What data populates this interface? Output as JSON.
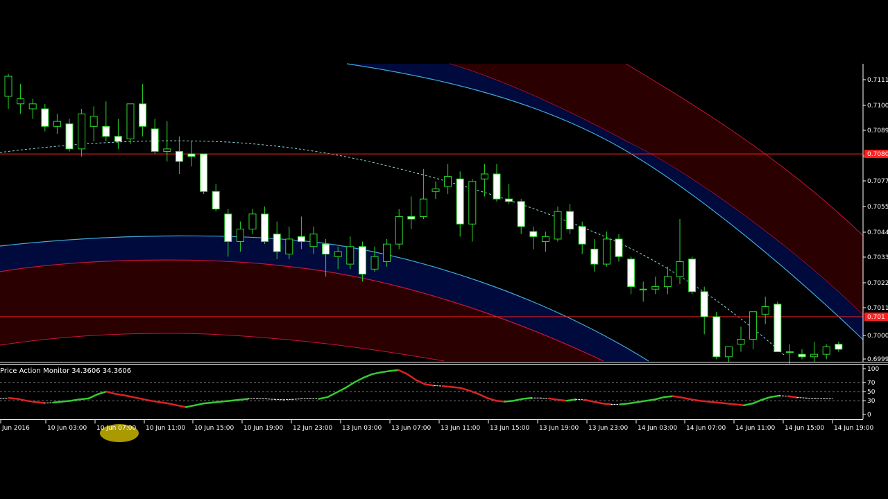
{
  "indicator": {
    "label": "Price Action Monitor 34.3606 34.3606",
    "levels": [
      "100",
      "70",
      "50",
      "30",
      "0"
    ]
  },
  "price_axis": {
    "labels": [
      "0.7111",
      "0.7100",
      "0.7089",
      "0.708",
      "0.7077",
      "0.7055",
      "0.7044",
      "0.7033",
      "0.7022",
      "0.7011",
      "0.7000",
      "0.6999"
    ]
  },
  "horizontal_lines": [
    {
      "price": 0.708,
      "label": "0.7080",
      "color": "#ff1f1f"
    },
    {
      "price": 0.7015,
      "label": "0.701",
      "color": "#ff1f1f"
    }
  ],
  "time_axis": {
    "labels": [
      "Jun 2016",
      "10 Jun 03:00",
      "10 Jun 07:00",
      "10 Jun 11:00",
      "10 Jun 15:00",
      "10 Jun 19:00",
      "12 Jun 23:00",
      "13 Jun 03:00",
      "13 Jun 07:00",
      "13 Jun 11:00",
      "13 Jun 15:00",
      "13 Jun 19:00",
      "13 Jun 23:00",
      "14 Jun 03:00",
      "14 Jun 07:00",
      "14 Jun 11:00",
      "14 Jun 15:00",
      "14 Jun 19:00"
    ]
  },
  "colors": {
    "background": "#000000",
    "candle_bull_fill": "#000000",
    "candle_bear_fill": "#ffffff",
    "candle_wick": "#2bd92b",
    "band_red_fill": "#2a0000",
    "band_red_line": "#c8143c",
    "band_blue_fill": "#000a3c",
    "band_blue_line": "#3fa9d8",
    "ma_dotted": "#8fdcdc",
    "indicator_up": "#33cc33",
    "indicator_down": "#dd2222",
    "indicator_neutral": "#ffffff"
  },
  "chart_data": {
    "type": "candlestick",
    "symbol_price_axis": "right",
    "ylim": [
      0.6997,
      0.7116
    ],
    "candles": [
      {
        "o": 0.7103,
        "h": 0.7112,
        "l": 0.7098,
        "c": 0.7111
      },
      {
        "o": 0.71,
        "h": 0.7108,
        "l": 0.7096,
        "c": 0.7102
      },
      {
        "o": 0.7098,
        "h": 0.7102,
        "l": 0.7094,
        "c": 0.71
      },
      {
        "o": 0.7098,
        "h": 0.71,
        "l": 0.7089,
        "c": 0.7091
      },
      {
        "o": 0.7091,
        "h": 0.7096,
        "l": 0.7088,
        "c": 0.7093
      },
      {
        "o": 0.7092,
        "h": 0.7094,
        "l": 0.7081,
        "c": 0.7082
      },
      {
        "o": 0.7082,
        "h": 0.7098,
        "l": 0.7079,
        "c": 0.7096
      },
      {
        "o": 0.7091,
        "h": 0.7099,
        "l": 0.7085,
        "c": 0.7095
      },
      {
        "o": 0.7091,
        "h": 0.7101,
        "l": 0.7085,
        "c": 0.7087
      },
      {
        "o": 0.7087,
        "h": 0.7094,
        "l": 0.7082,
        "c": 0.7085
      },
      {
        "o": 0.7086,
        "h": 0.71,
        "l": 0.7084,
        "c": 0.71
      },
      {
        "o": 0.71,
        "h": 0.7108,
        "l": 0.7087,
        "c": 0.7091
      },
      {
        "o": 0.709,
        "h": 0.7094,
        "l": 0.708,
        "c": 0.7081
      },
      {
        "o": 0.7081,
        "h": 0.7093,
        "l": 0.7077,
        "c": 0.7082
      },
      {
        "o": 0.7081,
        "h": 0.7087,
        "l": 0.7072,
        "c": 0.7077
      },
      {
        "o": 0.708,
        "h": 0.7085,
        "l": 0.7075,
        "c": 0.7079
      },
      {
        "o": 0.708,
        "h": 0.708,
        "l": 0.7064,
        "c": 0.7065
      },
      {
        "o": 0.7065,
        "h": 0.7068,
        "l": 0.7057,
        "c": 0.7058
      },
      {
        "o": 0.7056,
        "h": 0.7058,
        "l": 0.7039,
        "c": 0.7045
      },
      {
        "o": 0.7045,
        "h": 0.7053,
        "l": 0.7041,
        "c": 0.705
      },
      {
        "o": 0.705,
        "h": 0.7058,
        "l": 0.7048,
        "c": 0.7056
      },
      {
        "o": 0.7056,
        "h": 0.7059,
        "l": 0.7044,
        "c": 0.7045
      },
      {
        "o": 0.7048,
        "h": 0.7053,
        "l": 0.7038,
        "c": 0.7041
      },
      {
        "o": 0.704,
        "h": 0.7051,
        "l": 0.7038,
        "c": 0.7046
      },
      {
        "o": 0.7047,
        "h": 0.7055,
        "l": 0.7042,
        "c": 0.7045
      },
      {
        "o": 0.7043,
        "h": 0.7051,
        "l": 0.704,
        "c": 0.7048
      },
      {
        "o": 0.7044,
        "h": 0.7046,
        "l": 0.7031,
        "c": 0.704
      },
      {
        "o": 0.7039,
        "h": 0.7043,
        "l": 0.7034,
        "c": 0.7041
      },
      {
        "o": 0.7036,
        "h": 0.7047,
        "l": 0.7034,
        "c": 0.7043
      },
      {
        "o": 0.7043,
        "h": 0.7045,
        "l": 0.7029,
        "c": 0.7032
      },
      {
        "o": 0.7034,
        "h": 0.7043,
        "l": 0.7033,
        "c": 0.7039
      },
      {
        "o": 0.7037,
        "h": 0.7046,
        "l": 0.7035,
        "c": 0.7044
      },
      {
        "o": 0.7044,
        "h": 0.7058,
        "l": 0.7042,
        "c": 0.7055
      },
      {
        "o": 0.7055,
        "h": 0.7063,
        "l": 0.705,
        "c": 0.7054
      },
      {
        "o": 0.7055,
        "h": 0.7074,
        "l": 0.7054,
        "c": 0.7062
      },
      {
        "o": 0.7065,
        "h": 0.7069,
        "l": 0.7062,
        "c": 0.7066
      },
      {
        "o": 0.7067,
        "h": 0.7076,
        "l": 0.7064,
        "c": 0.7071
      },
      {
        "o": 0.707,
        "h": 0.7073,
        "l": 0.7047,
        "c": 0.7052
      },
      {
        "o": 0.7052,
        "h": 0.707,
        "l": 0.7045,
        "c": 0.7069
      },
      {
        "o": 0.707,
        "h": 0.7076,
        "l": 0.7063,
        "c": 0.7072
      },
      {
        "o": 0.7072,
        "h": 0.7076,
        "l": 0.7061,
        "c": 0.7062
      },
      {
        "o": 0.7062,
        "h": 0.7068,
        "l": 0.706,
        "c": 0.7061
      },
      {
        "o": 0.7061,
        "h": 0.7062,
        "l": 0.7048,
        "c": 0.7051
      },
      {
        "o": 0.7049,
        "h": 0.7051,
        "l": 0.7042,
        "c": 0.7047
      },
      {
        "o": 0.7045,
        "h": 0.7049,
        "l": 0.7041,
        "c": 0.7047
      },
      {
        "o": 0.7046,
        "h": 0.7059,
        "l": 0.7045,
        "c": 0.7057
      },
      {
        "o": 0.7057,
        "h": 0.706,
        "l": 0.7048,
        "c": 0.705
      },
      {
        "o": 0.7051,
        "h": 0.7053,
        "l": 0.704,
        "c": 0.7044
      },
      {
        "o": 0.7042,
        "h": 0.7046,
        "l": 0.7033,
        "c": 0.7036
      },
      {
        "o": 0.7036,
        "h": 0.7049,
        "l": 0.7035,
        "c": 0.7046
      },
      {
        "o": 0.7046,
        "h": 0.7048,
        "l": 0.7037,
        "c": 0.7039
      },
      {
        "o": 0.7038,
        "h": 0.7039,
        "l": 0.7024,
        "c": 0.7027
      },
      {
        "o": 0.7026,
        "h": 0.7029,
        "l": 0.7021,
        "c": 0.7026
      },
      {
        "o": 0.7026,
        "h": 0.7031,
        "l": 0.7024,
        "c": 0.7027
      },
      {
        "o": 0.7027,
        "h": 0.7035,
        "l": 0.7024,
        "c": 0.7031
      },
      {
        "o": 0.7031,
        "h": 0.7054,
        "l": 0.7028,
        "c": 0.7037
      },
      {
        "o": 0.7038,
        "h": 0.7039,
        "l": 0.7024,
        "c": 0.7025
      },
      {
        "o": 0.7025,
        "h": 0.7027,
        "l": 0.7008,
        "c": 0.7015
      },
      {
        "o": 0.7015,
        "h": 0.7017,
        "l": 0.6998,
        "c": 0.6999
      },
      {
        "o": 0.6999,
        "h": 0.7003,
        "l": 0.6997,
        "c": 0.7003
      },
      {
        "o": 0.7004,
        "h": 0.7011,
        "l": 0.7001,
        "c": 0.7006
      },
      {
        "o": 0.7006,
        "h": 0.7017,
        "l": 0.7002,
        "c": 0.7017
      },
      {
        "o": 0.7016,
        "h": 0.7023,
        "l": 0.7012,
        "c": 0.7019
      },
      {
        "o": 0.702,
        "h": 0.7021,
        "l": 0.7001,
        "c": 0.7001
      },
      {
        "o": 0.7001,
        "h": 0.7004,
        "l": 0.6996,
        "c": 0.7001
      },
      {
        "o": 0.7,
        "h": 0.7002,
        "l": 0.6998,
        "c": 0.6999
      },
      {
        "o": 0.6999,
        "h": 0.7005,
        "l": 0.6997,
        "c": 0.7
      },
      {
        "o": 0.7,
        "h": 0.7004,
        "l": 0.6998,
        "c": 0.7003
      },
      {
        "o": 0.7004,
        "h": 0.7005,
        "l": 0.7001,
        "c": 0.7002
      }
    ],
    "indicator": {
      "name": "Price Action Monitor",
      "ylim": [
        0,
        100
      ],
      "levels": [
        100,
        70,
        50,
        30,
        0
      ],
      "values": [
        35,
        36,
        34,
        30,
        27,
        25,
        26,
        28,
        30,
        33,
        35,
        44,
        50,
        45,
        42,
        38,
        34,
        30,
        27,
        24,
        20,
        16,
        20,
        24,
        26,
        28,
        30,
        32,
        34,
        35,
        34,
        33,
        32,
        33,
        34,
        35,
        34,
        38,
        48,
        58,
        70,
        80,
        88,
        92,
        95,
        97,
        88,
        75,
        66,
        63,
        62,
        60,
        58,
        52,
        45,
        36,
        30,
        28,
        30,
        34,
        36,
        36,
        35,
        32,
        30,
        33,
        32,
        28,
        24,
        22,
        22,
        24,
        27,
        30,
        33,
        38,
        40,
        37,
        33,
        30,
        28,
        26,
        24,
        22,
        20,
        24,
        32,
        38,
        41,
        40,
        37,
        36,
        35,
        34,
        34
      ]
    }
  }
}
